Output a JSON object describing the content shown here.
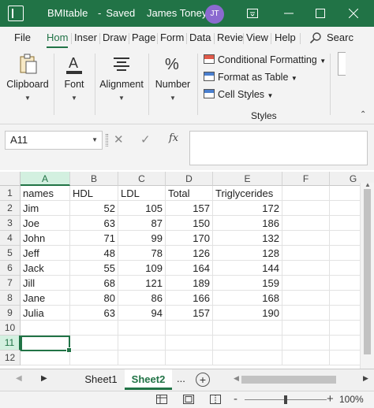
{
  "window": {
    "filename": "BMItable",
    "save_status": "Saved",
    "user_name": "James Toney",
    "user_initials": "JT"
  },
  "tabs": [
    {
      "label": "File"
    },
    {
      "label": "Hom",
      "active": true
    },
    {
      "label": "Inser"
    },
    {
      "label": "Draw"
    },
    {
      "label": "Page"
    },
    {
      "label": "Form"
    },
    {
      "label": "Data"
    },
    {
      "label": "Revie"
    },
    {
      "label": "View"
    },
    {
      "label": "Help"
    }
  ],
  "search": {
    "label": "Searc"
  },
  "ribbon": {
    "clipboard": "Clipboard",
    "font": "Font",
    "alignment": "Alignment",
    "number": "Number",
    "conditional_formatting": "Conditional Formatting",
    "format_as_table": "Format as Table",
    "cell_styles": "Cell Styles",
    "styles_group": "Styles"
  },
  "formula_bar": {
    "name_box": "A11",
    "fx_label": "fx",
    "formula": ""
  },
  "grid": {
    "columns": [
      "A",
      "B",
      "C",
      "D",
      "E",
      "F",
      "G"
    ],
    "row_numbers": [
      "1",
      "2",
      "3",
      "4",
      "5",
      "6",
      "7",
      "8",
      "9",
      "10",
      "11",
      "12"
    ],
    "selected_cell": "A11",
    "rows": [
      [
        "names",
        "HDL",
        "LDL",
        "Total",
        "Triglycerides"
      ],
      [
        "Jim",
        "52",
        "105",
        "157",
        "172"
      ],
      [
        "Joe",
        "63",
        "87",
        "150",
        "186"
      ],
      [
        "John",
        "71",
        "99",
        "170",
        "132"
      ],
      [
        "Jeff",
        "48",
        "78",
        "126",
        "128"
      ],
      [
        "Jack",
        "55",
        "109",
        "164",
        "144"
      ],
      [
        "Jill",
        "68",
        "121",
        "189",
        "159"
      ],
      [
        "Jane",
        "80",
        "86",
        "166",
        "168"
      ],
      [
        "Julia",
        "63",
        "94",
        "157",
        "190"
      ]
    ]
  },
  "sheets": [
    {
      "label": "Sheet1",
      "active": false
    },
    {
      "label": "Sheet2",
      "active": true
    }
  ],
  "more_sheets": "...",
  "status": {
    "zoom_minus": "-",
    "zoom_plus": "+",
    "zoom": "100%",
    "zoom_fraction": 0.5
  },
  "colors": {
    "accent": "#217346",
    "avatar": "#8b6ad0"
  }
}
